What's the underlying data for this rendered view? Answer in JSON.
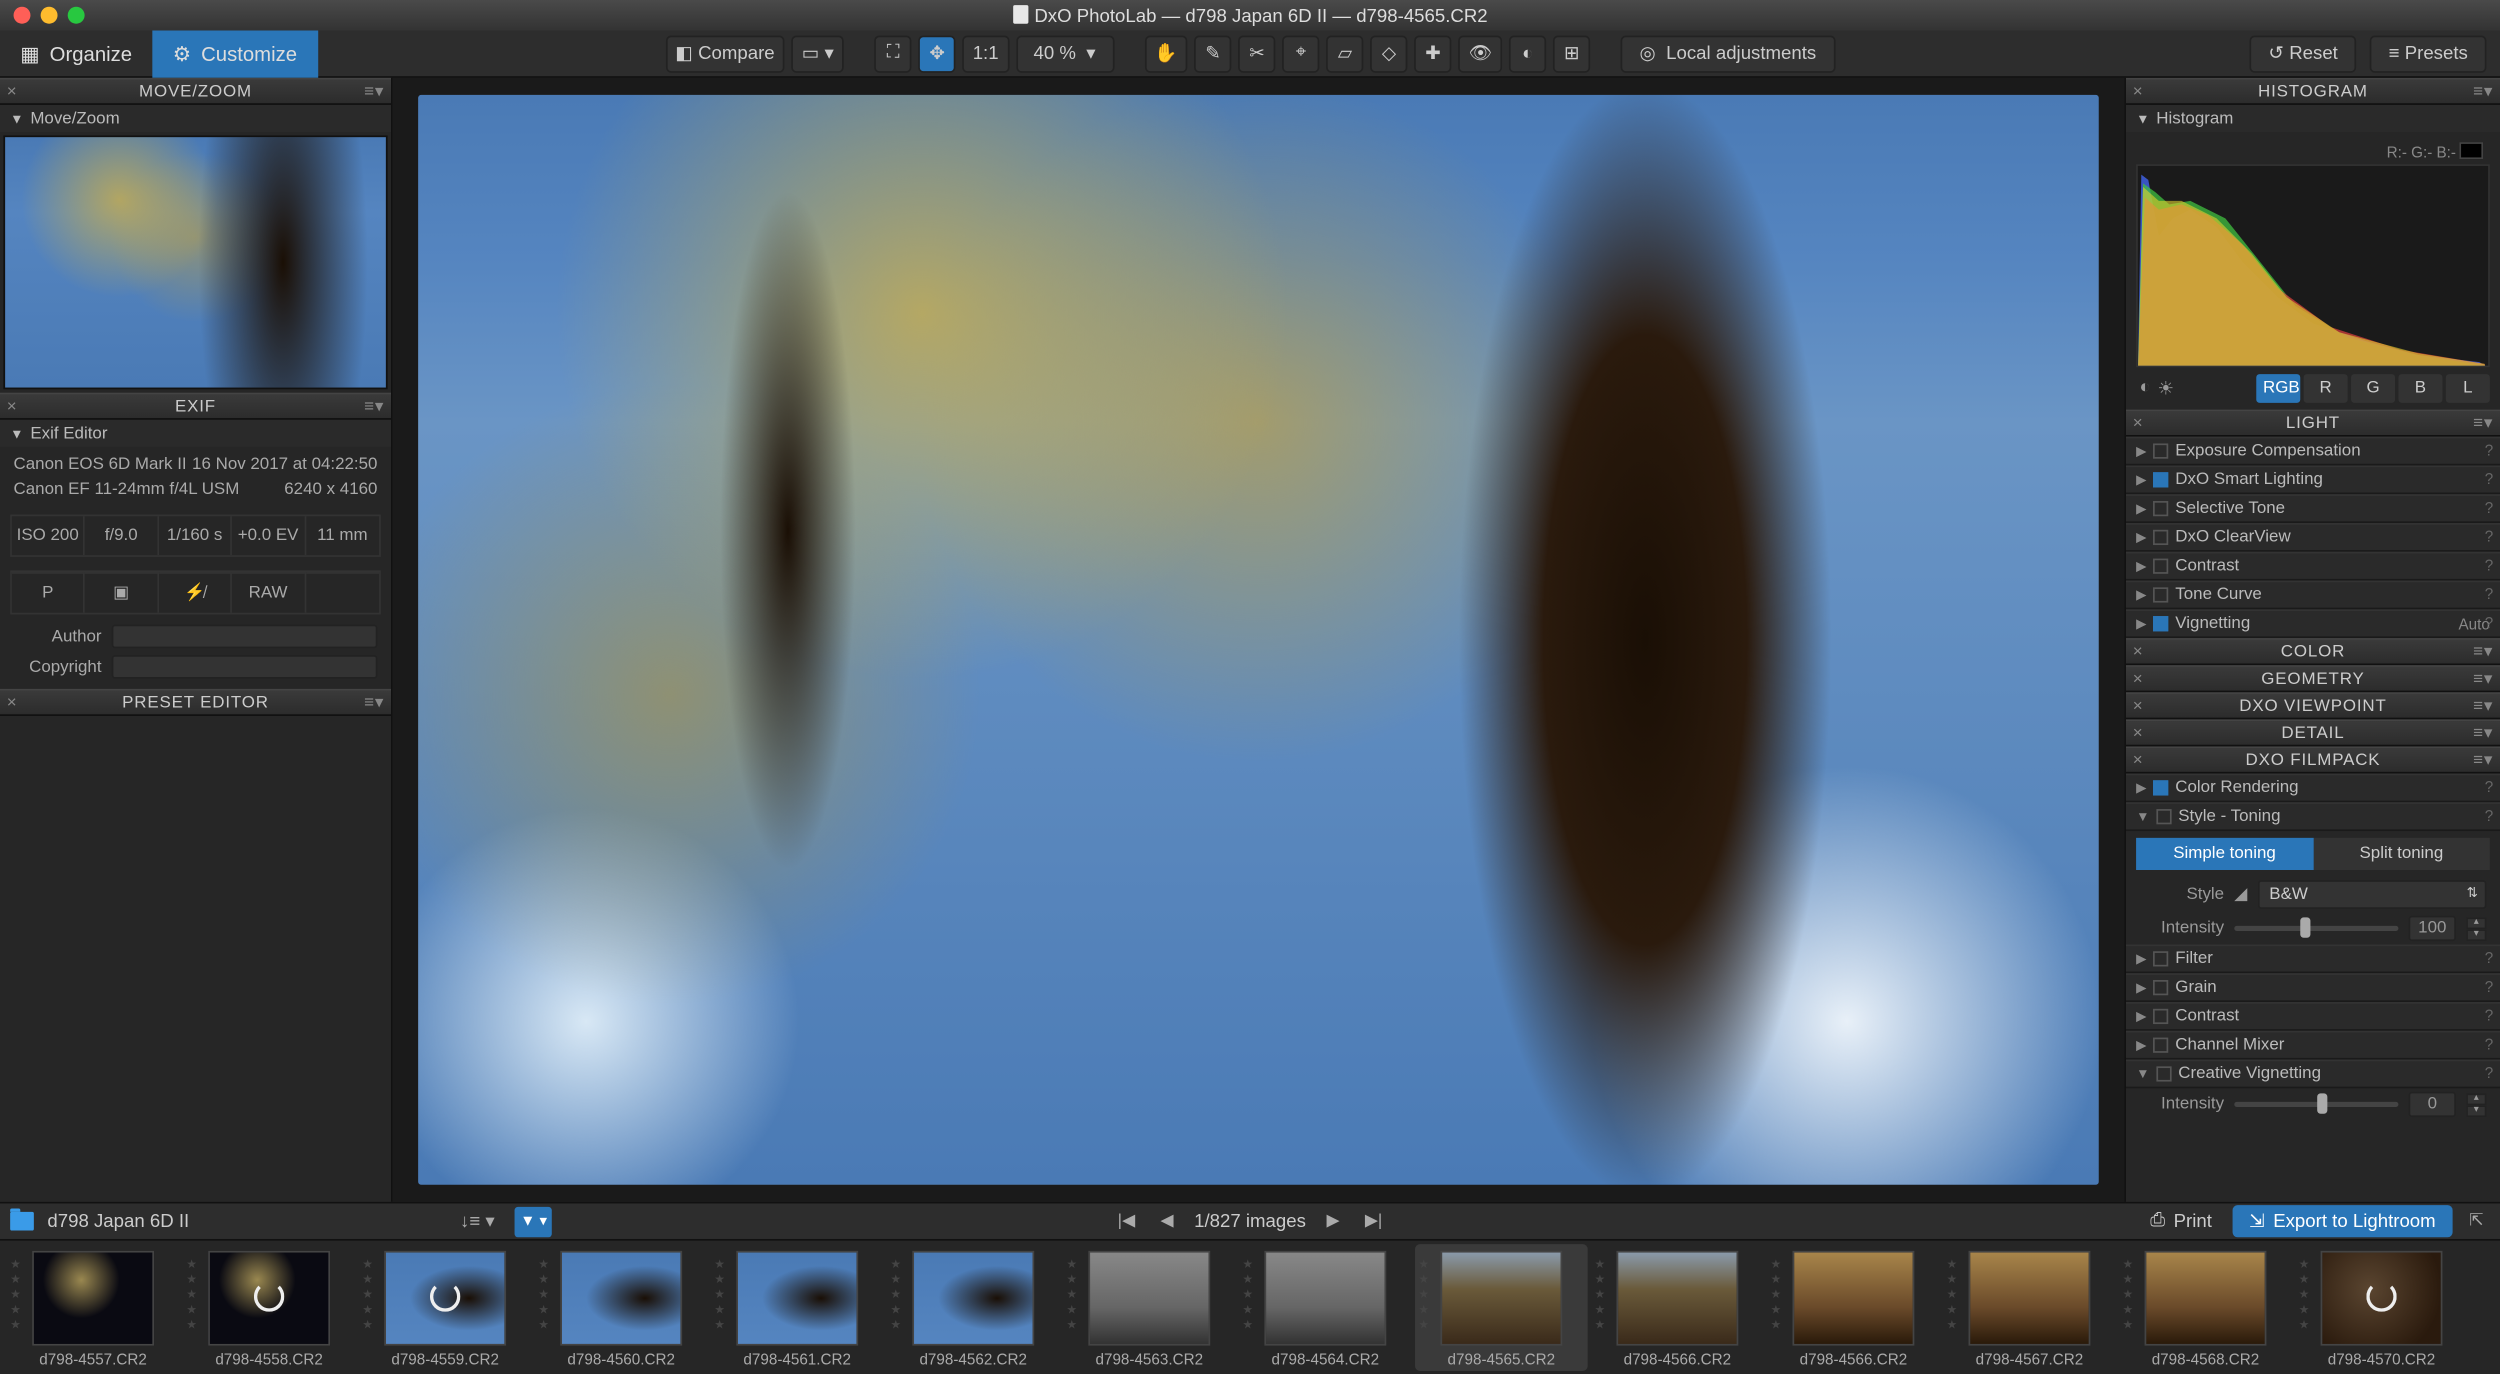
{
  "titlebar": {
    "title": "DxO PhotoLab — d798 Japan 6D II — d798-4565.CR2"
  },
  "tabs": {
    "organize": "Organize",
    "customize": "Customize"
  },
  "toolbar": {
    "compare": "Compare",
    "ratio": "1:1",
    "zoom": "40 %",
    "local_adj": "Local adjustments",
    "reset": "Reset",
    "presets": "Presets"
  },
  "panels": {
    "movezoom": {
      "title": "MOVE/ZOOM",
      "sub": "Move/Zoom"
    },
    "exif": {
      "title": "EXIF",
      "sub": "Exif Editor",
      "camera": "Canon EOS 6D Mark II",
      "date": "16 Nov 2017 at 04:22:50",
      "lens": "Canon EF 11-24mm f/4L USM",
      "dims": "6240 x 4160",
      "iso": "ISO 200",
      "f": "f/9.0",
      "shutter": "1/160 s",
      "ev": "+0.0 EV",
      "fl": "11 mm",
      "mode": "P",
      "raw": "RAW",
      "author_lbl": "Author",
      "copyright_lbl": "Copyright"
    },
    "preset": {
      "title": "PRESET EDITOR"
    },
    "histogram": {
      "title": "HISTOGRAM",
      "sub": "Histogram",
      "rgb_readout": "R:- G:- B:-",
      "btns": [
        "RGB",
        "R",
        "G",
        "B",
        "L"
      ]
    },
    "light": {
      "title": "LIGHT",
      "items": [
        {
          "label": "Exposure Compensation",
          "chk": false
        },
        {
          "label": "DxO Smart Lighting",
          "chk": true
        },
        {
          "label": "Selective Tone",
          "chk": false
        },
        {
          "label": "DxO ClearView",
          "chk": false
        },
        {
          "label": "Contrast",
          "chk": false
        },
        {
          "label": "Tone Curve",
          "chk": false
        },
        {
          "label": "Vignetting",
          "chk": true,
          "tag": "Auto"
        }
      ]
    },
    "color": {
      "title": "COLOR"
    },
    "geometry": {
      "title": "GEOMETRY"
    },
    "viewpoint": {
      "title": "DXO VIEWPOINT"
    },
    "detail": {
      "title": "DETAIL"
    },
    "filmpack": {
      "title": "DXO FILMPACK",
      "color_rendering": "Color Rendering",
      "style_toning": "Style - Toning",
      "simple": "Simple toning",
      "split": "Split toning",
      "style_lbl": "Style",
      "style_val": "B&W",
      "intensity_lbl": "Intensity",
      "intensity_val": "100",
      "filter": "Filter",
      "grain": "Grain",
      "contrast": "Contrast",
      "mixer": "Channel Mixer",
      "vig": "Creative Vignetting",
      "vig_intensity": "Intensity",
      "vig_val": "0"
    }
  },
  "bottom": {
    "folder": "d798 Japan 6D II",
    "counter": "1/827 images",
    "print": "Print",
    "export": "Export to Lightroom",
    "thumbs": [
      {
        "n": "d798-4557.CR2",
        "c": "th-dark"
      },
      {
        "n": "d798-4558.CR2",
        "c": "th-dark",
        "b": true
      },
      {
        "n": "d798-4559.CR2",
        "c": "th-tree",
        "b": true
      },
      {
        "n": "d798-4560.CR2",
        "c": "th-tree"
      },
      {
        "n": "d798-4561.CR2",
        "c": "th-tree"
      },
      {
        "n": "d798-4562.CR2",
        "c": "th-tree"
      },
      {
        "n": "d798-4563.CR2",
        "c": "th-person"
      },
      {
        "n": "d798-4564.CR2",
        "c": "th-person"
      },
      {
        "n": "d798-4565.CR2",
        "c": "th-wide",
        "sel": true
      },
      {
        "n": "d798-4566.CR2",
        "c": "th-wide"
      },
      {
        "n": "d798-4566.CR2",
        "c": "th-warm"
      },
      {
        "n": "d798-4567.CR2",
        "c": "th-warm"
      },
      {
        "n": "d798-4568.CR2",
        "c": "th-warm"
      },
      {
        "n": "d798-4570.CR2",
        "c": "th-bark",
        "b": true
      }
    ]
  }
}
